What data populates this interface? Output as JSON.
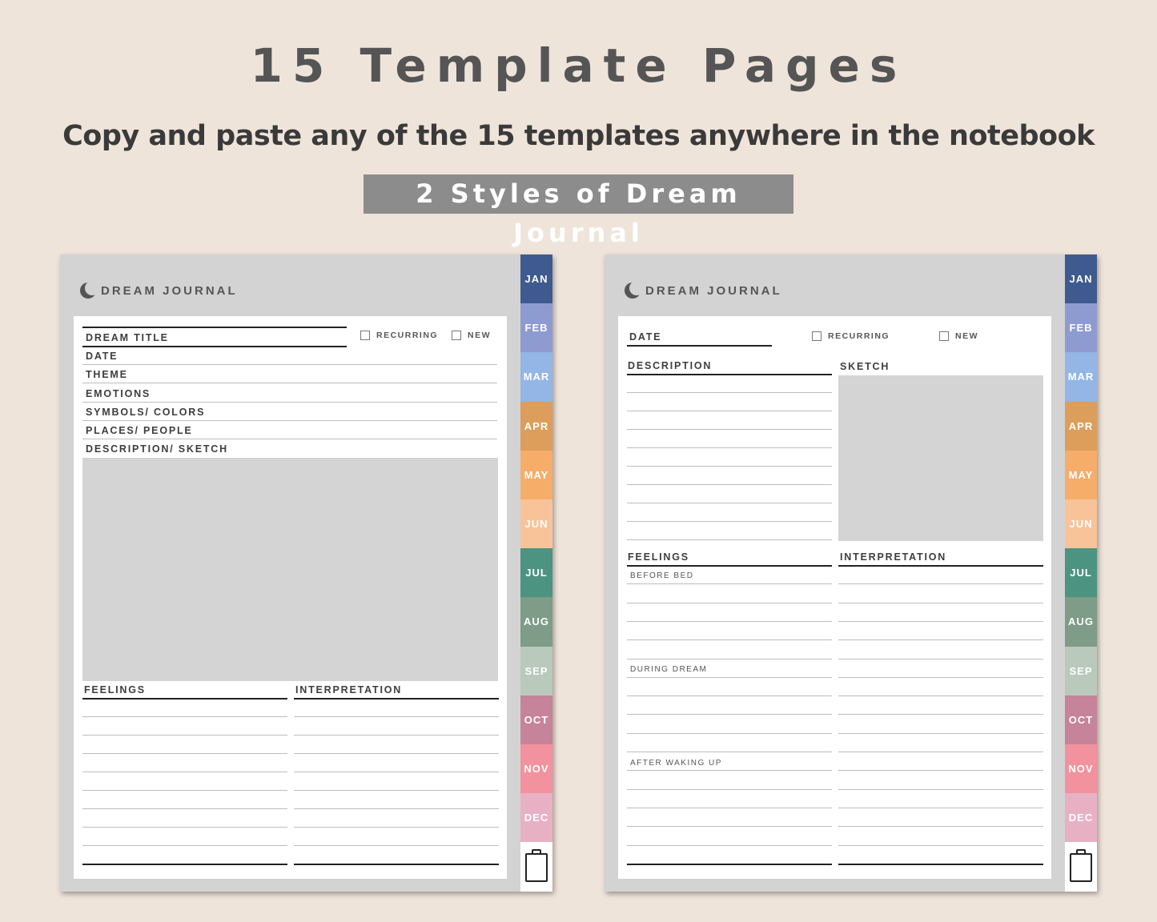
{
  "heading": {
    "title": "15 Template Pages",
    "subtitle": "Copy and paste any of the 15 templates anywhere in the notebook",
    "banner": "2 Styles of Dream Journal"
  },
  "months": [
    {
      "label": "JAN",
      "color": "#3e5a8e"
    },
    {
      "label": "FEB",
      "color": "#8e9bd0"
    },
    {
      "label": "MAR",
      "color": "#93b6e6"
    },
    {
      "label": "APR",
      "color": "#dc9e5a"
    },
    {
      "label": "MAY",
      "color": "#f6ad6a"
    },
    {
      "label": "JUN",
      "color": "#f8c399"
    },
    {
      "label": "JUL",
      "color": "#4c9382"
    },
    {
      "label": "AUG",
      "color": "#7e9c88"
    },
    {
      "label": "SEP",
      "color": "#b9c9bb"
    },
    {
      "label": "OCT",
      "color": "#c68399"
    },
    {
      "label": "NOV",
      "color": "#f2929e"
    },
    {
      "label": "DEC",
      "color": "#e8b1c3"
    }
  ],
  "style_a": {
    "header": "DREAM JOURNAL",
    "fields": [
      "DREAM TITLE",
      "DATE",
      "THEME",
      "EMOTIONS",
      "SYMBOLS/ COLORS",
      "PLACES/ PEOPLE",
      "DESCRIPTION/ SKETCH"
    ],
    "recurring_label": "RECURRING",
    "new_label": "NEW",
    "feelings_label": "FEELINGS",
    "interpretation_label": "INTERPRETATION"
  },
  "style_b": {
    "header": "DREAM JOURNAL",
    "date_label": "DATE",
    "recurring_label": "RECURRING",
    "new_label": "NEW",
    "description_label": "DESCRIPTION",
    "sketch_label": "SKETCH",
    "feelings_label": "FEELINGS",
    "interpretation_label": "INTERPRETATION",
    "before_bed": "BEFORE BED",
    "during_dream": "DURING DREAM",
    "after_waking": "AFTER WAKING UP"
  }
}
